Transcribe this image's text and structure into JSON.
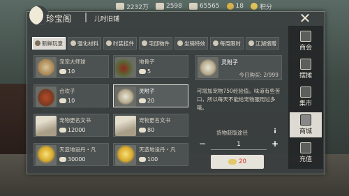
{
  "topbar": {
    "silver": "2232万",
    "tickets": "2598",
    "jade": "65565",
    "other": "18",
    "points_label": "积分"
  },
  "header": {
    "title": "珍宝阁",
    "subtitle": "儿时旧铺",
    "close_icon": "✕"
  },
  "tabs": [
    {
      "label": "新鲜玩意",
      "icon": "gift-icon"
    },
    {
      "label": "强化材料",
      "icon": "gear-icon"
    },
    {
      "label": "时装挂件",
      "icon": "clothes-icon"
    },
    {
      "label": "宅邸物件",
      "icon": "house-icon"
    },
    {
      "label": "坐骑特效",
      "icon": "horse-icon"
    },
    {
      "label": "每周限时",
      "icon": "clock-icon"
    },
    {
      "label": "江湖馈赠",
      "icon": "present-icon"
    }
  ],
  "items": [
    {
      "name": "宠宠大师球",
      "price": "10"
    },
    {
      "name": "地骨子",
      "price": "5"
    },
    {
      "name": "合欢子",
      "price": "10"
    },
    {
      "name": "灵附子",
      "price": "20"
    },
    {
      "name": "宠物更名文书",
      "price": "12000"
    },
    {
      "name": "宠物更名文书",
      "price": "80"
    },
    {
      "name": "天造地设丹・凡",
      "price": "30000"
    },
    {
      "name": "天造地设丹・凡",
      "price": "100"
    }
  ],
  "detail": {
    "name": "灵附子",
    "limit": "今日购买: 2/999",
    "desc": "可增加宠物750经验值。味道有些苦口，所以每天不能给宠物服用过多哦。",
    "source_label": "货物获取途径",
    "info_label": "i",
    "quantity": "1",
    "minus": "−",
    "plus": "+",
    "buy_price": "20"
  },
  "sidebar": [
    {
      "label": "商会",
      "icon": "guild-icon"
    },
    {
      "label": "摆摊",
      "icon": "stall-icon"
    },
    {
      "label": "集市",
      "icon": "market-icon"
    },
    {
      "label": "商城",
      "icon": "shop-icon",
      "active": true
    },
    {
      "label": "充值",
      "icon": "recharge-icon"
    }
  ]
}
